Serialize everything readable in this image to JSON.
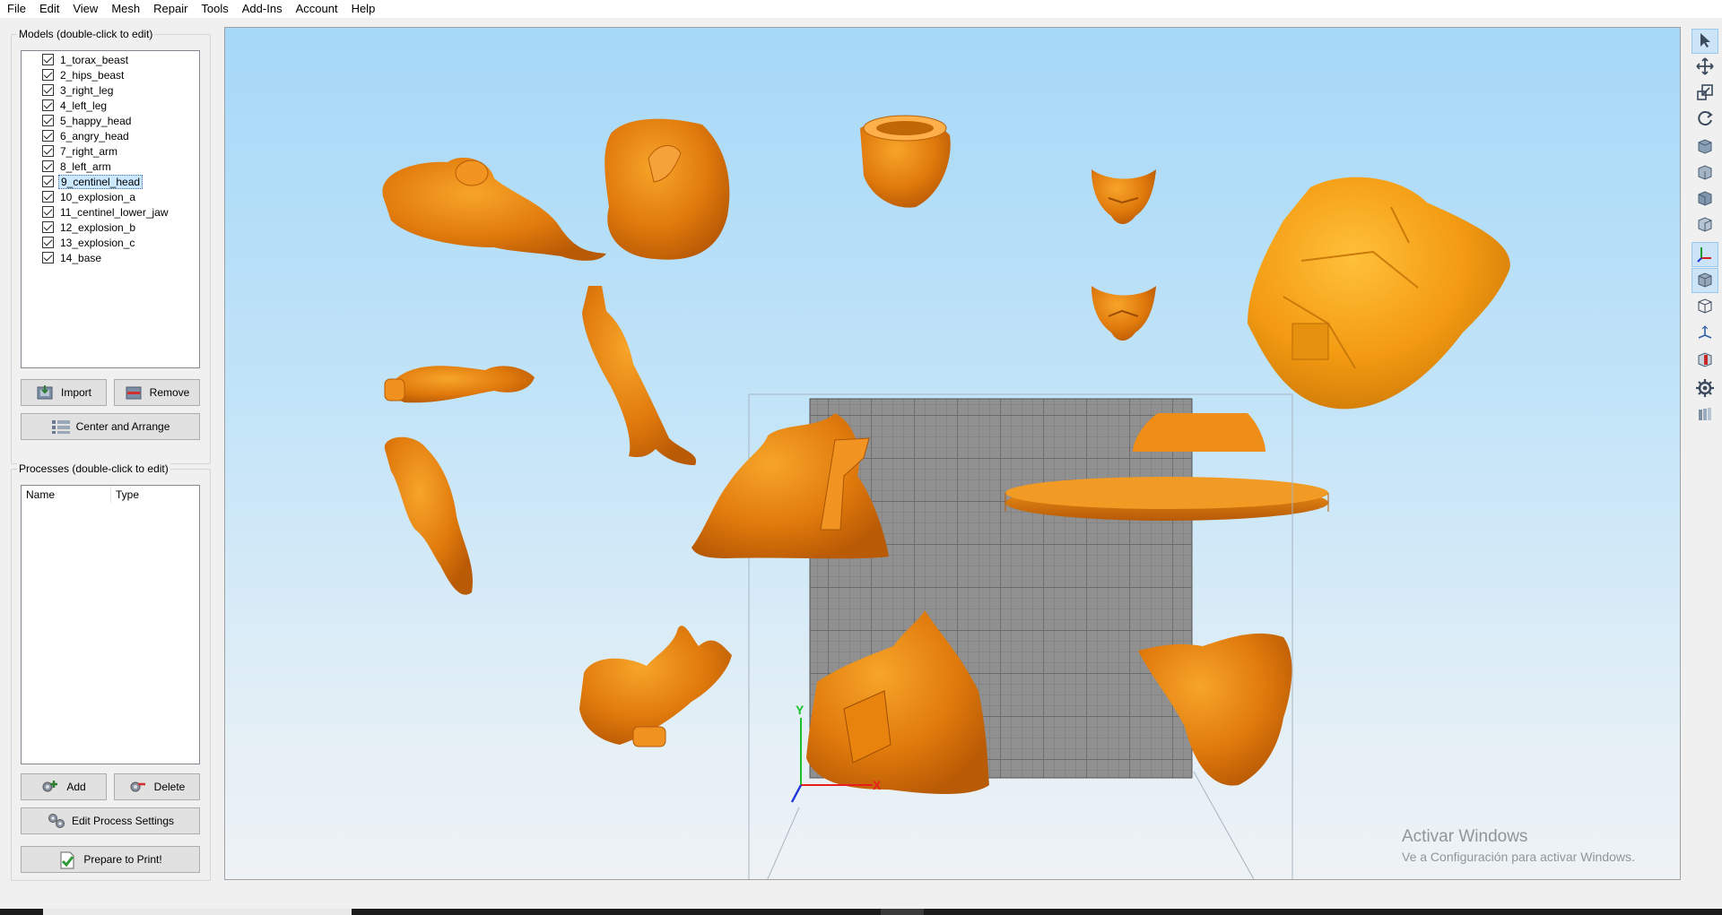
{
  "menu": [
    "File",
    "Edit",
    "View",
    "Mesh",
    "Repair",
    "Tools",
    "Add-Ins",
    "Account",
    "Help"
  ],
  "models": {
    "title": "Models (double-click to edit)",
    "items": [
      {
        "label": "1_torax_beast",
        "checked": true
      },
      {
        "label": "2_hips_beast",
        "checked": true
      },
      {
        "label": "3_right_leg",
        "checked": true
      },
      {
        "label": "4_left_leg",
        "checked": true
      },
      {
        "label": "5_happy_head",
        "checked": true
      },
      {
        "label": "6_angry_head",
        "checked": true
      },
      {
        "label": "7_right_arm",
        "checked": true
      },
      {
        "label": "8_left_arm",
        "checked": true
      },
      {
        "label": "9_centinel_head",
        "checked": true,
        "selected": true
      },
      {
        "label": "10_explosion_a",
        "checked": true
      },
      {
        "label": "11_centinel_lower_jaw",
        "checked": true
      },
      {
        "label": "12_explosion_b",
        "checked": true
      },
      {
        "label": "13_explosion_c",
        "checked": true
      },
      {
        "label": "14_base",
        "checked": true
      }
    ],
    "import_label": "Import",
    "remove_label": "Remove",
    "center_label": "Center and Arrange"
  },
  "processes": {
    "title": "Processes (double-click to edit)",
    "columns": [
      "Name",
      "Type"
    ],
    "add_label": "Add",
    "delete_label": "Delete",
    "edit_label": "Edit Process Settings",
    "prepare_label": "Prepare to Print!"
  },
  "viewport": {
    "axis_y": "Y",
    "axis_x": "X",
    "model_color": "#e8820c",
    "bed_color": "#8e8e8e"
  },
  "watermark": {
    "title": "Activar Windows",
    "subtitle": "Ve a Configuración para activar Windows."
  },
  "toolbar_icons": [
    "select-icon",
    "move-icon",
    "scale-icon",
    "rotate-icon",
    "view-front-icon",
    "view-back-icon",
    "view-left-icon",
    "view-right-icon",
    "axes-icon",
    "solid-view-icon",
    "wireframe-icon",
    "build-volume-icon",
    "cross-section-icon",
    "settings-icon",
    "layers-icon"
  ]
}
